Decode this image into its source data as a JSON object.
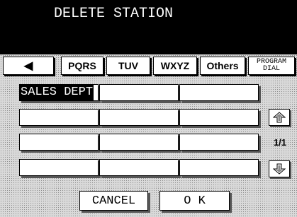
{
  "screen": {
    "title": "DELETE STATION"
  },
  "tabs": {
    "back_icon": "◀",
    "items": [
      "PQRS",
      "TUV",
      "WXYZ",
      "Others"
    ],
    "program_dial": [
      "PROGRAM",
      "DIAL"
    ]
  },
  "grid": {
    "rows": [
      [
        "SALES DEPT",
        "",
        ""
      ],
      [
        "",
        "",
        ""
      ],
      [
        "",
        "",
        ""
      ],
      [
        "",
        "",
        ""
      ]
    ],
    "selected_cell": "SALES DEPT"
  },
  "paging": {
    "up_icon": "arrow-up-icon",
    "down_icon": "arrow-down-icon",
    "indicator": "1/1"
  },
  "footer": {
    "cancel_label": "CANCEL",
    "ok_label": "O K"
  },
  "colors": {
    "header_bg": "#000000",
    "dither_bg": "#d9d9d9",
    "selected_bg": "#000000"
  }
}
